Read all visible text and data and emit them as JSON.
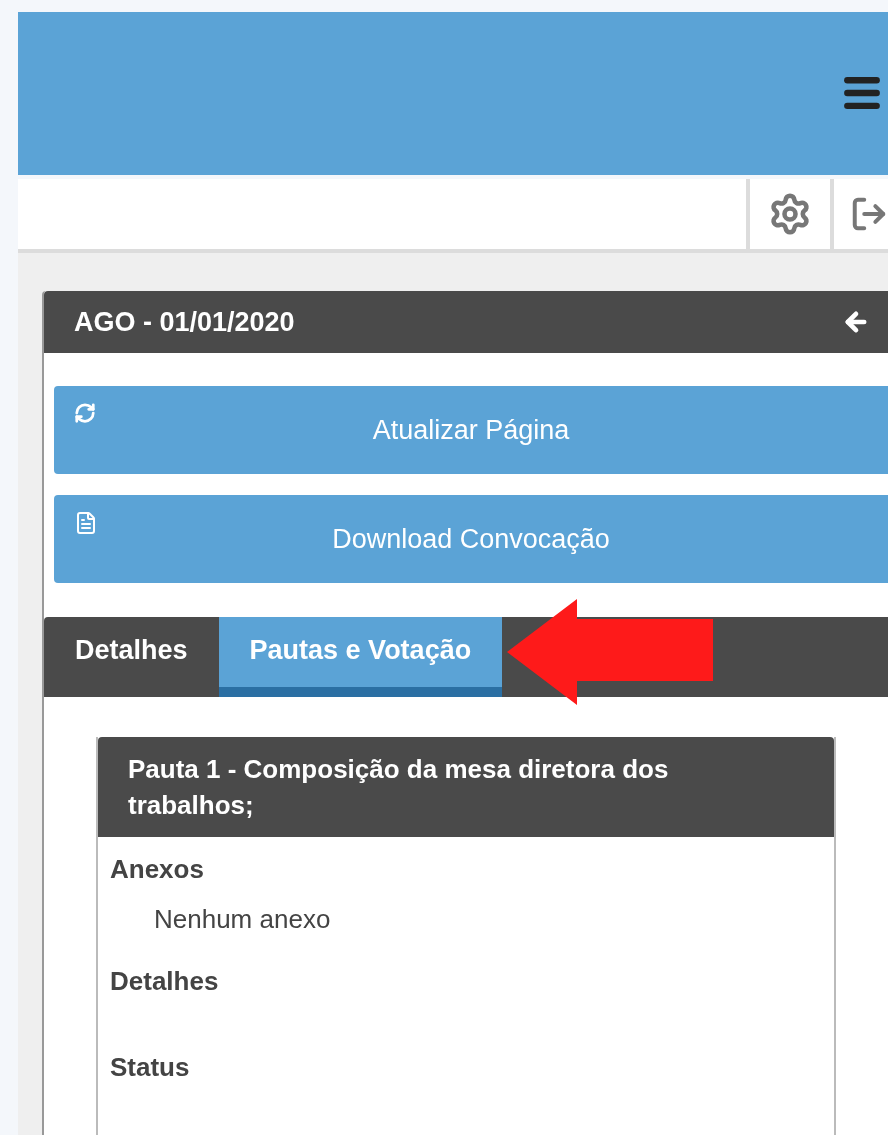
{
  "panel": {
    "title": "AGO - 01/01/2020"
  },
  "buttons": [
    {
      "label": "Atualizar Página",
      "kind": "refresh"
    },
    {
      "label": "Download Convocação",
      "kind": "pdf"
    }
  ],
  "tabs": [
    {
      "label": "Detalhes",
      "selected": false
    },
    {
      "label": "Pautas e Votação",
      "selected": true
    }
  ],
  "pauta": {
    "title": "Pauta 1 - Composição da mesa diretora dos trabalhos;",
    "sections": [
      {
        "heading": "Anexos",
        "text": "Nenhum anexo"
      },
      {
        "heading": "Detalhes"
      },
      {
        "heading": "Status"
      }
    ]
  }
}
